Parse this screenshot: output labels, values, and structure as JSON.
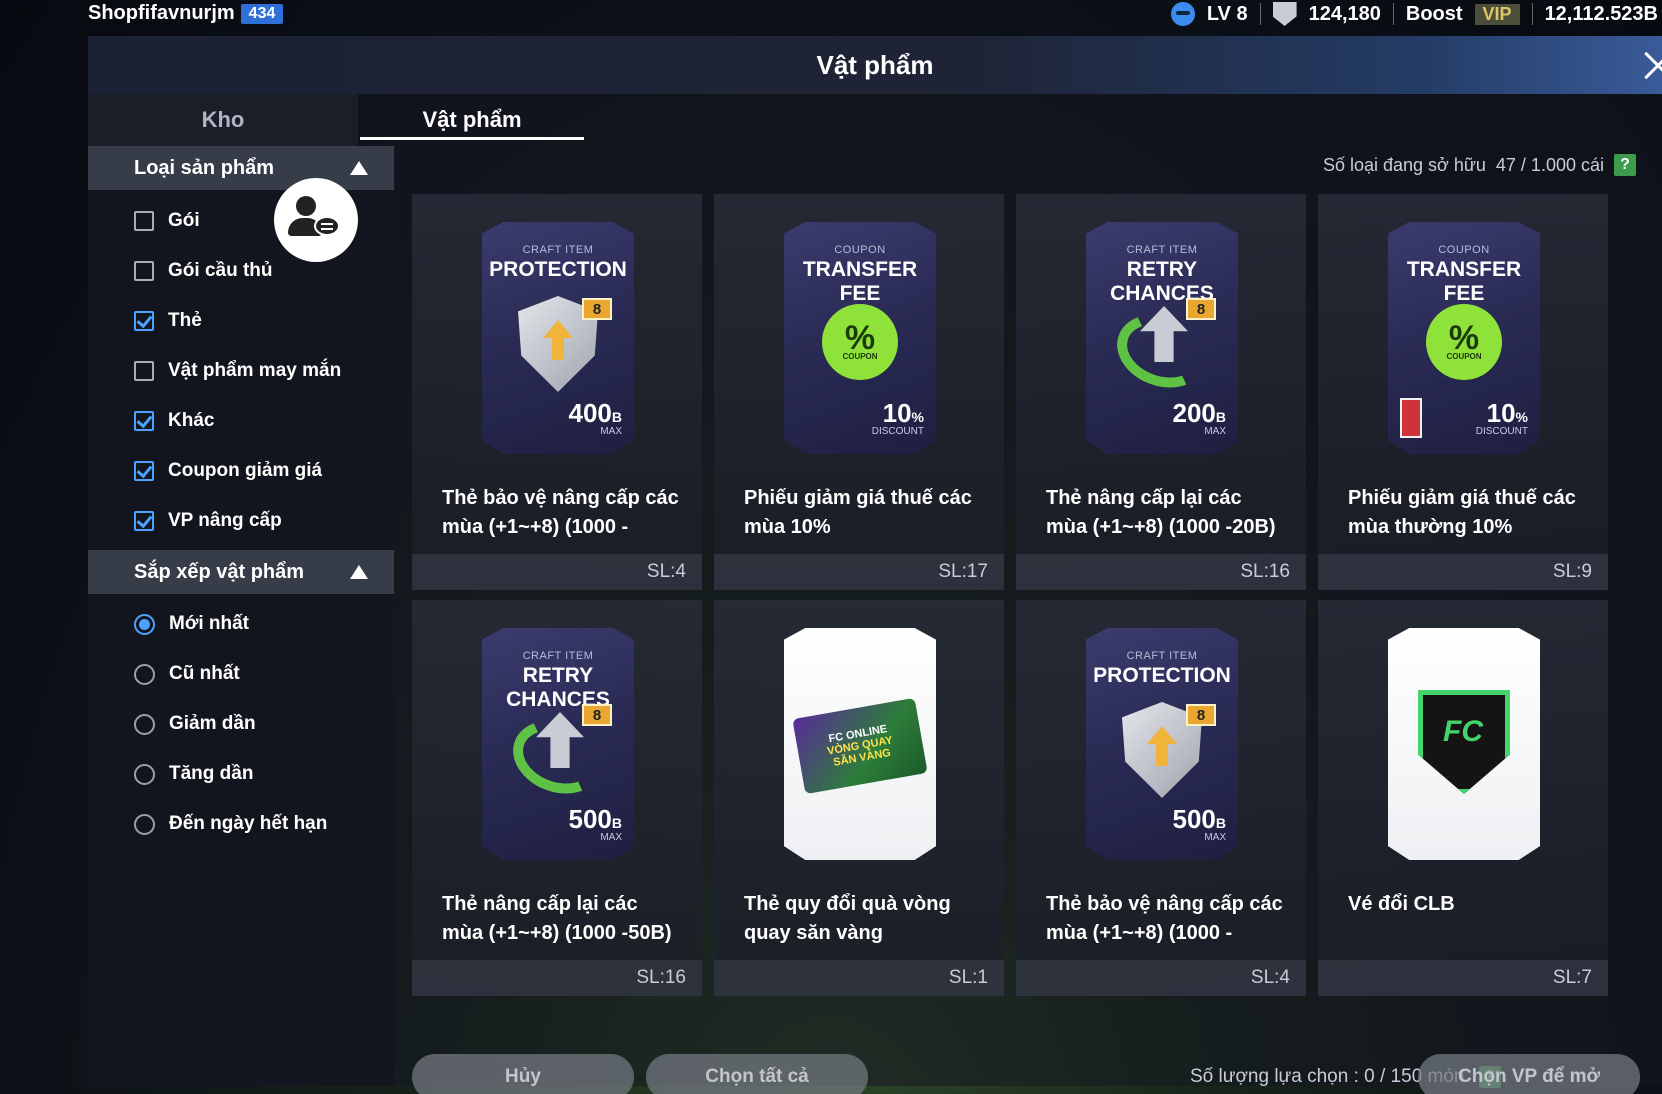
{
  "topbar": {
    "username": "Shopfifavnurjm",
    "user_badge": "434",
    "level": "LV 8",
    "coins": "124,180",
    "boost_label": "Boost",
    "vip_label": "VIP",
    "balance": "12,112.523B"
  },
  "window": {
    "title": "Vật phẩm",
    "tabs": [
      "Kho",
      "Vật phẩm"
    ]
  },
  "filters": {
    "product_type_title": "Loại sản phẩm",
    "product_types": [
      {
        "label": "Gói",
        "checked": false
      },
      {
        "label": "Gói cầu thủ",
        "checked": false
      },
      {
        "label": "Thẻ",
        "checked": true
      },
      {
        "label": "Vật phẩm may mắn",
        "checked": false
      },
      {
        "label": "Khác",
        "checked": true
      },
      {
        "label": "Coupon giảm giá",
        "checked": true
      },
      {
        "label": "VP nâng cấp",
        "checked": true
      }
    ],
    "sort_title": "Sắp xếp vật phẩm",
    "sort_options": [
      {
        "label": "Mới nhất",
        "selected": true
      },
      {
        "label": "Cũ nhất",
        "selected": false
      },
      {
        "label": "Giảm dần",
        "selected": false
      },
      {
        "label": "Tăng dần",
        "selected": false
      },
      {
        "label": "Đến ngày hết hạn",
        "selected": false
      }
    ]
  },
  "owned": {
    "label": "Số loại đang sở hữu",
    "value": "47 / 1.000 cái",
    "help": "?"
  },
  "items": [
    {
      "name": "Thẻ bảo vệ nâng cấp các mùa (+1~+8) (1000 -",
      "qty": "SL:4",
      "kind": "protection",
      "sub": "CRAFT ITEM",
      "title": "PROTECTION",
      "value": "400",
      "unit": "B",
      "unit_caption": "MAX",
      "badge": "8"
    },
    {
      "name": "Phiếu giảm giá thuế các mùa 10%",
      "qty": "SL:17",
      "kind": "coupon",
      "sub": "COUPON",
      "title": "TRANSFER FEE",
      "value": "10",
      "unit": "%",
      "unit_caption": "DISCOUNT",
      "coupon_symbol": "%",
      "coupon_caption": "COUPON"
    },
    {
      "name": "Thẻ nâng cấp lại các mùa (+1~+8) (1000 -20B)",
      "qty": "SL:16",
      "kind": "retry",
      "sub": "CRAFT ITEM",
      "title": "RETRY CHANCES",
      "value": "200",
      "unit": "B",
      "unit_caption": "MAX",
      "badge": "8"
    },
    {
      "name": "Phiếu giảm giá thuế các mùa thường 10%",
      "qty": "SL:9",
      "kind": "coupon-locked",
      "sub": "COUPON",
      "title": "TRANSFER FEE",
      "value": "10",
      "unit": "%",
      "unit_caption": "DISCOUNT",
      "coupon_symbol": "%",
      "coupon_caption": "COUPON"
    },
    {
      "name": "Thẻ nâng cấp lại các mùa (+1~+8) (1000 -50B)",
      "qty": "SL:16",
      "kind": "retry",
      "sub": "CRAFT ITEM",
      "title": "RETRY CHANCES",
      "value": "500",
      "unit": "B",
      "unit_caption": "MAX",
      "badge": "8"
    },
    {
      "name": "Thẻ quy đổi quà vòng quay săn vàng",
      "qty": "SL:1",
      "kind": "ticket",
      "ticket_line1": "FC ONLINE",
      "ticket_line2": "VÒNG QUAY",
      "ticket_line3": "SĂN VÀNG"
    },
    {
      "name": "Thẻ bảo vệ nâng cấp các mùa (+1~+8) (1000 -",
      "qty": "SL:4",
      "kind": "protection",
      "sub": "CRAFT ITEM",
      "title": "PROTECTION",
      "value": "500",
      "unit": "B",
      "unit_caption": "MAX",
      "badge": "8"
    },
    {
      "name": "Vé đổi CLB",
      "qty": "SL:7",
      "kind": "club"
    }
  ],
  "footer": {
    "cancel": "Hủy",
    "select_all": "Chọn tất cả",
    "selection_label": "Số lượng lựa chọn : 0 / 150 món",
    "help": "?",
    "open_button": "Chọn VP để mở"
  },
  "colors": {
    "accent": "#4aa3ff",
    "card_dark": "#2a2b55",
    "coupon_green": "#8ee23a",
    "help_green": "#3d9c4c"
  }
}
